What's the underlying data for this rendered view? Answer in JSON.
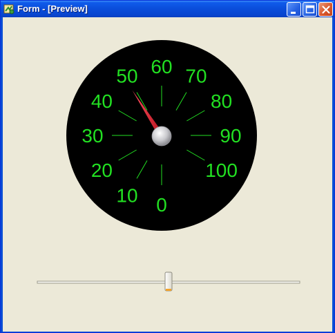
{
  "window": {
    "title": "Form - [Preview]",
    "icon": "form-designer-icon",
    "buttons": {
      "minimize": "minimize-icon",
      "maximize": "maximize-icon",
      "close": "close-icon"
    }
  },
  "gauge": {
    "face_color": "#000000",
    "label_color": "#22E022",
    "needle_color": "#E0202A",
    "tick_labels": [
      "0",
      "10",
      "20",
      "30",
      "40",
      "50",
      "60",
      "70",
      "80",
      "90",
      "100"
    ],
    "min": 0,
    "max": 100,
    "value": 49
  },
  "slider": {
    "min": 0,
    "max": 100,
    "value": 50
  }
}
